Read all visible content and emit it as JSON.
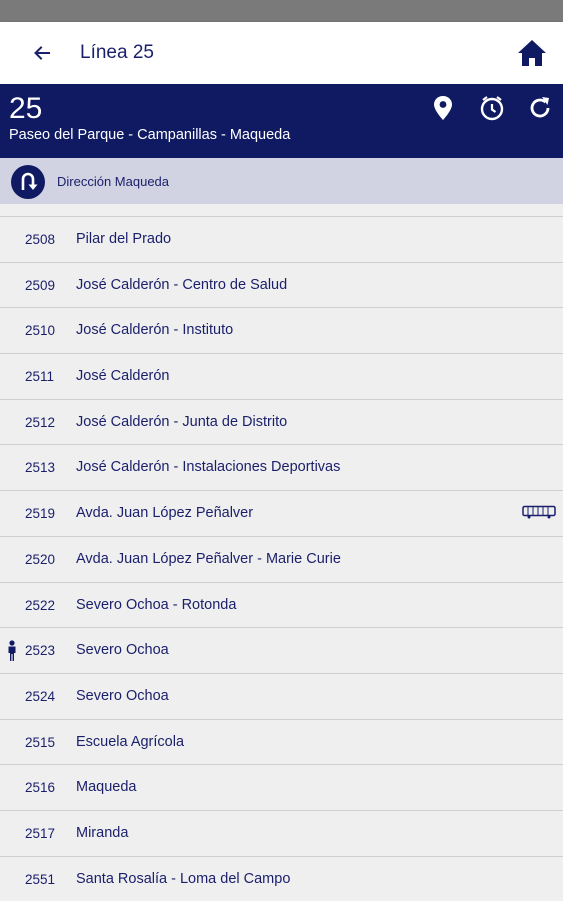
{
  "appbar": {
    "title": "Línea 25",
    "back_icon": "arrow-left-icon",
    "home_icon": "home-icon"
  },
  "colors": {
    "primary": "#0f1a63",
    "direction_bg": "#d2d3e2",
    "text": "#1a1f6b"
  },
  "line": {
    "number": "25",
    "route": "Paseo del Parque - Campanillas - Maqueda",
    "actions": [
      "map-pin-icon",
      "clock-icon",
      "refresh-icon"
    ]
  },
  "direction": {
    "label": "Dirección Maqueda",
    "icon": "u-turn-icon"
  },
  "stops": [
    {
      "code": "2508",
      "name": "Pilar del Prado"
    },
    {
      "code": "2509",
      "name": "José Calderón - Centro de Salud"
    },
    {
      "code": "2510",
      "name": "José Calderón - Instituto"
    },
    {
      "code": "2511",
      "name": "José Calderón"
    },
    {
      "code": "2512",
      "name": "José Calderón - Junta de Distrito"
    },
    {
      "code": "2513",
      "name": "José Calderón - Instalaciones Deportivas"
    },
    {
      "code": "2519",
      "name": "Avda. Juan López Peñalver",
      "marker": "bus-icon"
    },
    {
      "code": "2520",
      "name": "Avda. Juan López Peñalver - Marie Curie"
    },
    {
      "code": "2522",
      "name": "Severo Ochoa - Rotonda"
    },
    {
      "code": "2523",
      "name": "Severo Ochoa",
      "marker": "person-icon"
    },
    {
      "code": "2524",
      "name": "Severo Ochoa"
    },
    {
      "code": "2515",
      "name": "Escuela Agrícola"
    },
    {
      "code": "2516",
      "name": "Maqueda"
    },
    {
      "code": "2517",
      "name": "Miranda"
    },
    {
      "code": "2551",
      "name": "Santa Rosalía - Loma del Campo"
    }
  ]
}
